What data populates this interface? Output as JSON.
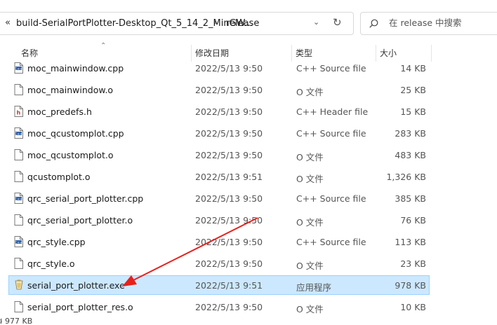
{
  "address": {
    "chevrons": "«",
    "crumb_parent": "build-SerialPortPlotter-Desktop_Qt_5_14_2_MinGW...",
    "separator": "›",
    "crumb_current": "release",
    "dropdown": "⌄",
    "refresh": "↻"
  },
  "search": {
    "placeholder": "在 release 中搜索"
  },
  "columns": {
    "name": "名称",
    "date": "修改日期",
    "type": "类型",
    "size": "大小",
    "sort": "⌃"
  },
  "files": [
    {
      "name": "moc_mainwindow.cpp",
      "date": "2022/5/13 9:50",
      "type": "C++ Source file",
      "size": "14 KB",
      "icon": "cpp-file-icon"
    },
    {
      "name": "moc_mainwindow.o",
      "date": "2022/5/13 9:50",
      "type": "O 文件",
      "size": "25 KB",
      "icon": "blank-file-icon"
    },
    {
      "name": "moc_predefs.h",
      "date": "2022/5/13 9:50",
      "type": "C++ Header file",
      "size": "15 KB",
      "icon": "header-file-icon"
    },
    {
      "name": "moc_qcustomplot.cpp",
      "date": "2022/5/13 9:50",
      "type": "C++ Source file",
      "size": "283 KB",
      "icon": "cpp-file-icon"
    },
    {
      "name": "moc_qcustomplot.o",
      "date": "2022/5/13 9:50",
      "type": "O 文件",
      "size": "483 KB",
      "icon": "blank-file-icon"
    },
    {
      "name": "qcustomplot.o",
      "date": "2022/5/13 9:51",
      "type": "O 文件",
      "size": "1,326 KB",
      "icon": "blank-file-icon"
    },
    {
      "name": "qrc_serial_port_plotter.cpp",
      "date": "2022/5/13 9:50",
      "type": "C++ Source file",
      "size": "385 KB",
      "icon": "cpp-file-icon"
    },
    {
      "name": "qrc_serial_port_plotter.o",
      "date": "2022/5/13 9:50",
      "type": "O 文件",
      "size": "76 KB",
      "icon": "blank-file-icon"
    },
    {
      "name": "qrc_style.cpp",
      "date": "2022/5/13 9:50",
      "type": "C++ Source file",
      "size": "113 KB",
      "icon": "cpp-file-icon"
    },
    {
      "name": "qrc_style.o",
      "date": "2022/5/13 9:50",
      "type": "O 文件",
      "size": "23 KB",
      "icon": "blank-file-icon"
    },
    {
      "name": "serial_port_plotter.exe",
      "date": "2022/5/13 9:51",
      "type": "应用程序",
      "size": "978 KB",
      "icon": "exe-app-icon",
      "selected": true
    },
    {
      "name": "serial_port_plotter_res.o",
      "date": "2022/5/13 9:50",
      "type": "O 文件",
      "size": "10 KB",
      "icon": "blank-file-icon"
    }
  ],
  "status": {
    "selection_size": "៛ 977 KB"
  },
  "annotation": {
    "arrow_color": "#e8201b"
  },
  "colors": {
    "selection_bg": "#cce8ff",
    "selection_border": "#99d1ff"
  }
}
